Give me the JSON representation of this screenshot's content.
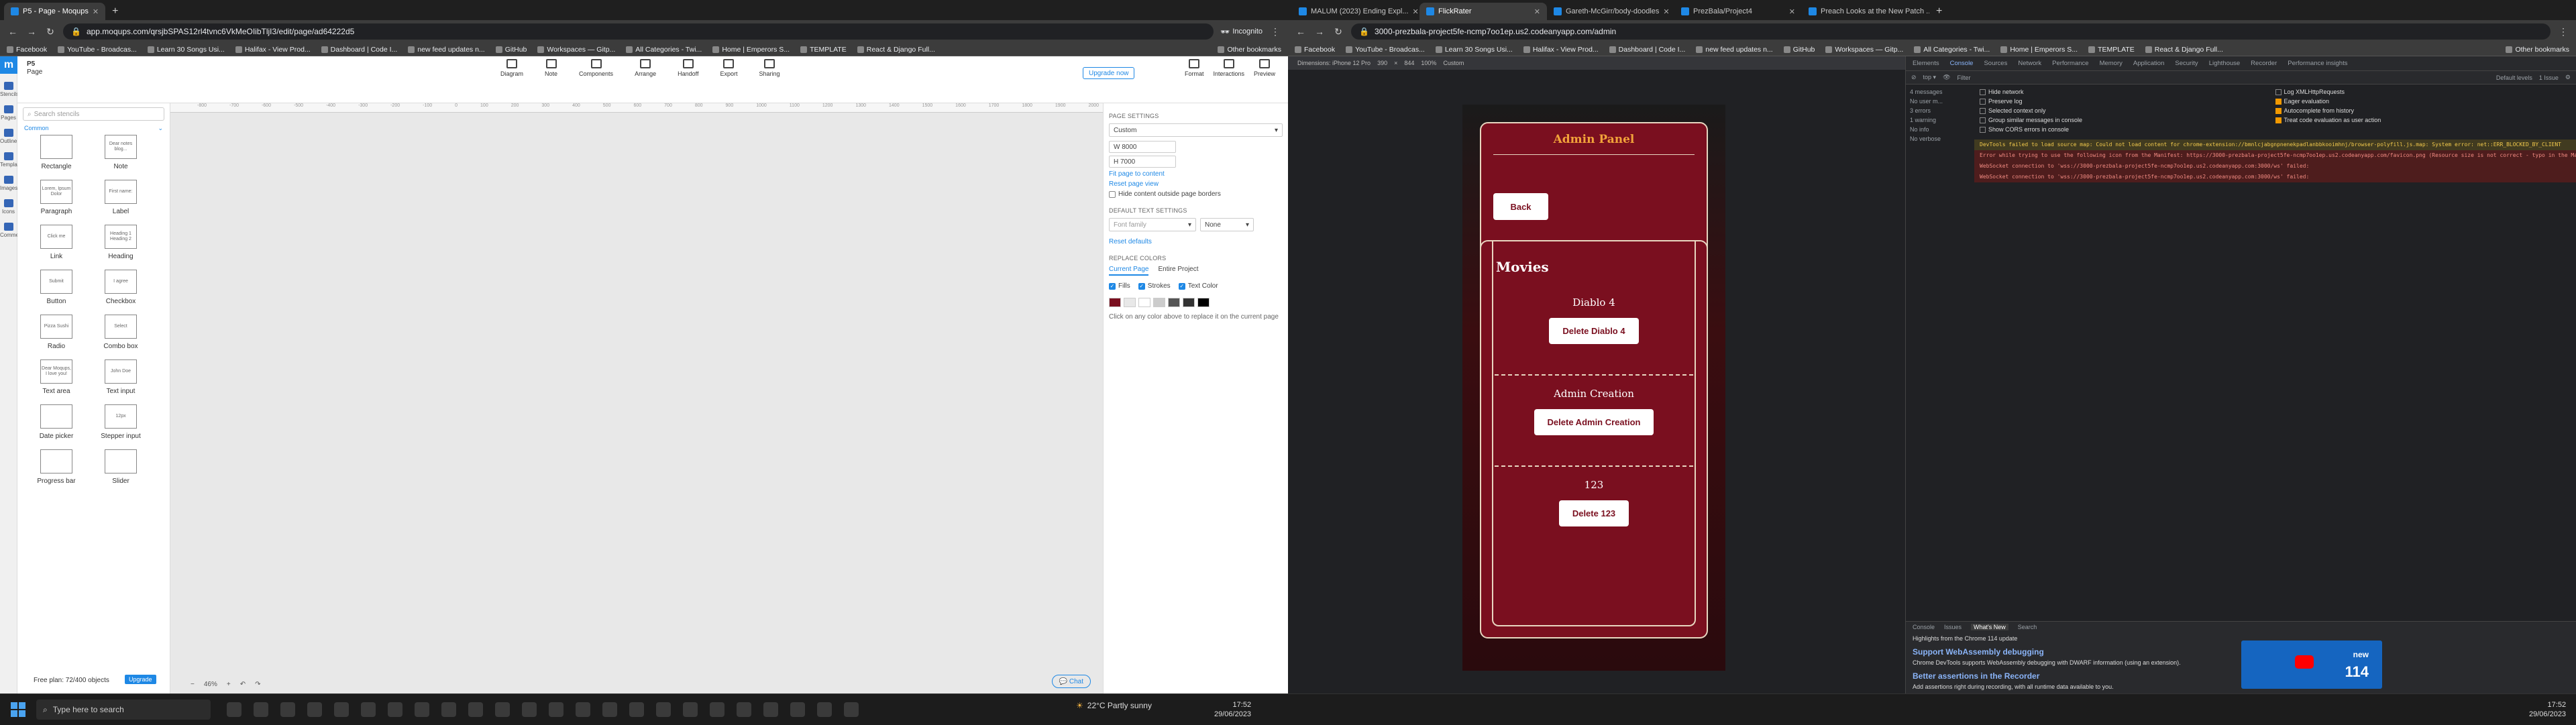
{
  "left_window": {
    "tabs": [
      {
        "label": "P5 - Page - Moqups",
        "active": true
      }
    ],
    "url": "app.moqups.com/qrsjbSPAS12rl4tvnc6VkMeOIibTljI3/edit/page/ad64222d5",
    "incognito_label": "Incognito",
    "bookmarks": [
      "Facebook",
      "YouTube - Broadcas...",
      "Learn 30 Songs Usi...",
      "Halifax - View Prod...",
      "Dashboard | Code I...",
      "new feed updates n...",
      "GitHub",
      "Workspaces — Gitp...",
      "All Categories - Twi...",
      "Home | Emperors S...",
      "TEMPLATE",
      "React & Django Full..."
    ],
    "other_bookmarks": "Other bookmarks"
  },
  "right_window": {
    "tabs": [
      {
        "label": "MALUM (2023) Ending Expl...",
        "active": false
      },
      {
        "label": "FlickRater",
        "active": true
      },
      {
        "label": "Gareth-McGirr/body-doodles",
        "active": false
      },
      {
        "label": "PrezBala/Project4",
        "active": false
      },
      {
        "label": "Preach Looks at the New Patch ...",
        "active": false
      }
    ],
    "url": "3000-prezbala-project5fe-ncmp7oo1ep.us2.codeanyapp.com/admin",
    "bookmarks": [
      "Facebook",
      "YouTube - Broadcas...",
      "Learn 30 Songs Usi...",
      "Halifax - View Prod...",
      "Dashboard | Code I...",
      "new feed updates n...",
      "GitHub",
      "Workspaces — Gitp...",
      "All Categories - Twi...",
      "Home | Emperors S...",
      "TEMPLATE",
      "React & Django Full..."
    ],
    "other_bookmarks": "Other bookmarks"
  },
  "moqups": {
    "page_title": "P5",
    "page_sub": "Page",
    "left_nav": [
      "Stencils",
      "Pages",
      "Outline",
      "Templates",
      "Images",
      "Icons",
      "Comments"
    ],
    "tools": [
      "Diagram",
      "Note",
      "Components",
      "Arrange",
      "Handoff",
      "Export",
      "Sharing"
    ],
    "upgrade_now": "Upgrade now",
    "right_tools": [
      "Format",
      "Interactions",
      "Preview"
    ],
    "search_placeholder": "Search stencils",
    "category": "Common",
    "stencils": [
      {
        "label": "Rectangle",
        "preview": ""
      },
      {
        "label": "Note",
        "preview": "Dear notes blog..."
      },
      {
        "label": "Paragraph",
        "preview": "Lorem, Ipsum Dolor"
      },
      {
        "label": "Label",
        "preview": "First name:"
      },
      {
        "label": "Link",
        "preview": "Click me"
      },
      {
        "label": "Heading",
        "preview": "Heading 1 Heading 2"
      },
      {
        "label": "Button",
        "preview": "Submit"
      },
      {
        "label": "Checkbox",
        "preview": "I agree"
      },
      {
        "label": "Radio",
        "preview": "Pizza Sushi"
      },
      {
        "label": "Combo box",
        "preview": "Select"
      },
      {
        "label": "Text area",
        "preview": "Dear Moqups, I love you!"
      },
      {
        "label": "Text input",
        "preview": "John Doe"
      },
      {
        "label": "Date picker",
        "preview": ""
      },
      {
        "label": "Stepper input",
        "preview": "12px"
      },
      {
        "label": "Progress bar",
        "preview": ""
      },
      {
        "label": "Slider",
        "preview": ""
      }
    ],
    "ruler": [
      "-800",
      "-700",
      "-600",
      "-500",
      "-400",
      "-300",
      "-200",
      "-100",
      "0",
      "100",
      "200",
      "300",
      "400",
      "500",
      "600",
      "700",
      "800",
      "900",
      "1000",
      "1100",
      "1200",
      "1300",
      "1400",
      "1500",
      "1600",
      "1700",
      "1800",
      "1900",
      "2000"
    ],
    "zoom": "46%",
    "chat": "Chat",
    "free_plan": "Free plan: 72/400 objects",
    "upgrade": "Upgrade",
    "panel": {
      "page_settings": "PAGE SETTINGS",
      "size_preset": "Custom",
      "width": "8000",
      "height": "7000",
      "fit_link": "Fit page to content",
      "reset_view": "Reset page view",
      "hide_outside": "Hide content outside page borders",
      "default_text": "DEFAULT TEXT SETTINGS",
      "font_family": "Font family",
      "font_style": "None",
      "reset_defaults": "Reset defaults",
      "replace_colors": "REPLACE COLORS",
      "tab_current": "Current Page",
      "tab_entire": "Entire Project",
      "fills": "Fills",
      "strokes": "Strokes",
      "text_color": "Text Color",
      "hint": "Click on any color above to replace it on the current page",
      "swatches": [
        "#7a0f1f",
        "#e8e8e8",
        "#ffffff",
        "#cccccc",
        "#555555",
        "#333333",
        "#000000"
      ]
    }
  },
  "device_bar": {
    "dimensions": "Dimensions: iPhone 12 Pro",
    "w": "390",
    "h": "844",
    "zoom": "100%",
    "throttle": "Custom"
  },
  "app": {
    "admin_title": "Admin Panel",
    "back": "Back",
    "movies_title": "Movies",
    "movies": [
      {
        "name": "Diablo 4",
        "button": "Delete Diablo 4"
      },
      {
        "name": "Admin Creation",
        "button": "Delete Admin Creation"
      },
      {
        "name": "123",
        "button": "Delete 123"
      }
    ],
    "colors": {
      "card": "#7a0f1f",
      "title": "#f2a33a"
    }
  },
  "devtools": {
    "tabs": [
      "Elements",
      "Console",
      "Sources",
      "Network",
      "Performance",
      "Memory",
      "Application",
      "Security",
      "Lighthouse",
      "Recorder",
      "Performance insights"
    ],
    "issues": "1 Issue",
    "filter_placeholder": "Filter",
    "default_levels": "Default levels",
    "sidebar": [
      "4 messages",
      "No user m...",
      "3 errors",
      "1 warning",
      "No info",
      "No verbose"
    ],
    "options": [
      "Hide network",
      "Log XMLHttpRequests",
      "Preserve log",
      "Eager evaluation",
      "Selected context only",
      "Autocomplete from history",
      "Group similar messages in console",
      "Treat code evaluation as user action",
      "Show CORS errors in console"
    ],
    "messages": [
      {
        "type": "warn",
        "text": "DevTools failed to load source map: Could not load content for chrome-extension://bmnlcjabgnpnenekpadlanbbkooimhnj/browser-polyfill.js.map: System error: net::ERR_BLOCKED_BY_CLIENT"
      },
      {
        "type": "err",
        "text": "Error while trying to use the following icon from the Manifest: https://3000-prezbala-project5fe-ncmp7oo1ep.us2.codeanyapp.com/favicon.png (Resource size is not correct - typo in the Manifest?)"
      },
      {
        "type": "err",
        "text": "WebSocket connection to 'wss://3000-prezbala-project5fe-ncmp7oo1ep.us2.codeanyapp.com:3000/ws' failed:"
      },
      {
        "type": "err",
        "text": "WebSocket connection to 'wss://3000-prezbala-project5fe-ncmp7oo1ep.us2.codeanyapp.com:3000/ws' failed:"
      }
    ],
    "drawer_tabs": [
      "Console",
      "Issues",
      "What's New",
      "Search"
    ],
    "whatsnew_head": "Highlights from the Chrome 114 update",
    "h1": "Support WebAssembly debugging",
    "p1": "Chrome DevTools supports WebAssembly debugging with DWARF information (using an extension).",
    "h2": "Better assertions in the Recorder",
    "p2": "Add assertions right during recording, with all runtime data available to you.",
    "promo_new": "new",
    "promo_ver": "114"
  },
  "taskbar": {
    "search_placeholder": "Type here to search",
    "weather": "22°C  Partly sunny",
    "time": "17:52",
    "date": "29/06/2023"
  }
}
